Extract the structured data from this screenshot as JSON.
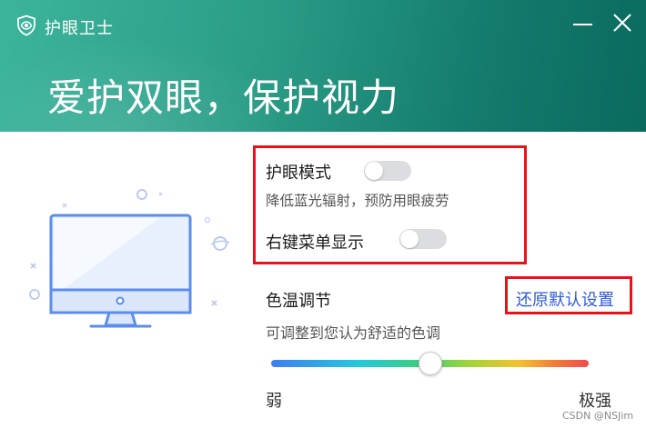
{
  "window": {
    "title": "护眼卫士",
    "slogan": "爱护双眼，保护视力"
  },
  "settings": {
    "eye_mode": {
      "label": "护眼模式",
      "description": "降低蓝光辐射，预防用眼疲劳",
      "enabled": false
    },
    "context_menu": {
      "label": "右键菜单显示",
      "enabled": false
    }
  },
  "color_temp": {
    "label": "色温调节",
    "description": "可调整到您认为舒适的色调",
    "reset_label": "还原默认设置",
    "min_label": "弱",
    "max_label": "极强",
    "value_fraction": 0.5
  },
  "watermark": "CSDN @NSJim",
  "icons": {
    "logo": "eye-shield-icon",
    "minimize": "minimize-icon",
    "close": "close-icon",
    "illustration": "monitor-illustration"
  },
  "colors": {
    "header_start": "#3cb49c",
    "header_end": "#0a6a5e",
    "highlight": "#e8121a",
    "link": "#2f5bd8",
    "toggle_off": "#dcdde1",
    "monitor": "#5b8def"
  }
}
